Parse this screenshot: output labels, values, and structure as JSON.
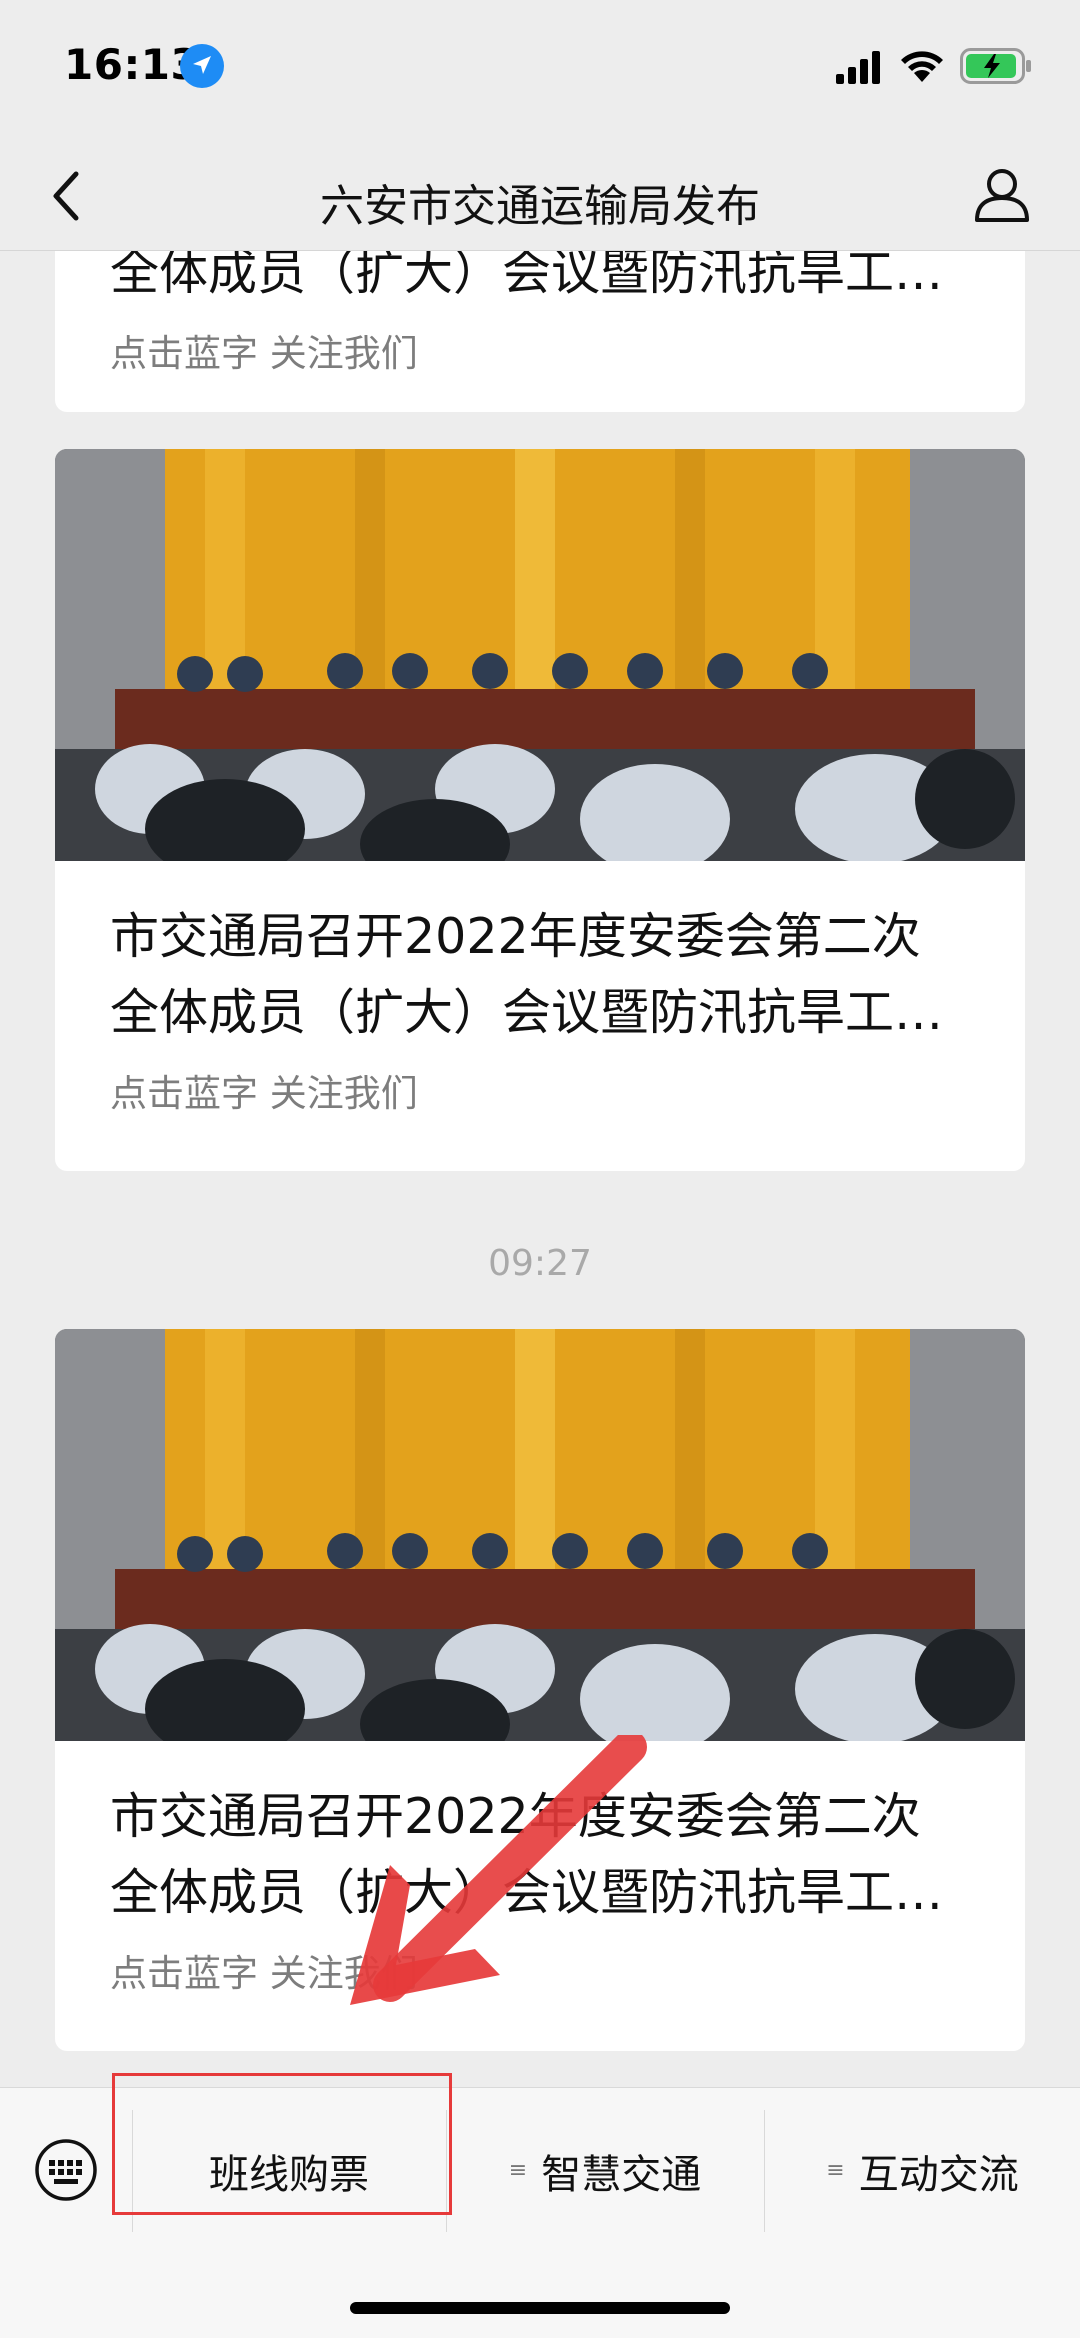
{
  "status_bar": {
    "time": "16:13",
    "icons": [
      "location-arrow-icon",
      "signal-icon",
      "wifi-icon",
      "battery-charging-icon"
    ],
    "battery_color": "#34c759"
  },
  "nav": {
    "title": "六安市交通运输局发布",
    "back_icon": "chevron-left-icon",
    "profile_icon": "person-icon"
  },
  "messages": [
    {
      "title_line2": "全体成员（扩大）会议暨防汛抗旱工…",
      "subtitle": "点击蓝字 关注我们"
    },
    {
      "title_line1": "市交通局召开2022年度安委会第二次",
      "title_line2": "全体成员（扩大）会议暨防汛抗旱工…",
      "subtitle": "点击蓝字 关注我们"
    },
    {
      "timestamp": "09:27",
      "title_line1": "市交通局召开2022年度安委会第二次",
      "title_line2": "全体成员（扩大）会议暨防汛抗旱工…",
      "subtitle": "点击蓝字 关注我们"
    }
  ],
  "bottom_menu": {
    "keyboard_icon": "keyboard-icon",
    "items": [
      {
        "label": "班线购票",
        "has_submenu": false
      },
      {
        "label": "智慧交通",
        "has_submenu": true
      },
      {
        "label": "互动交流",
        "has_submenu": true
      }
    ]
  },
  "annotation": {
    "color": "#e63a3a"
  }
}
